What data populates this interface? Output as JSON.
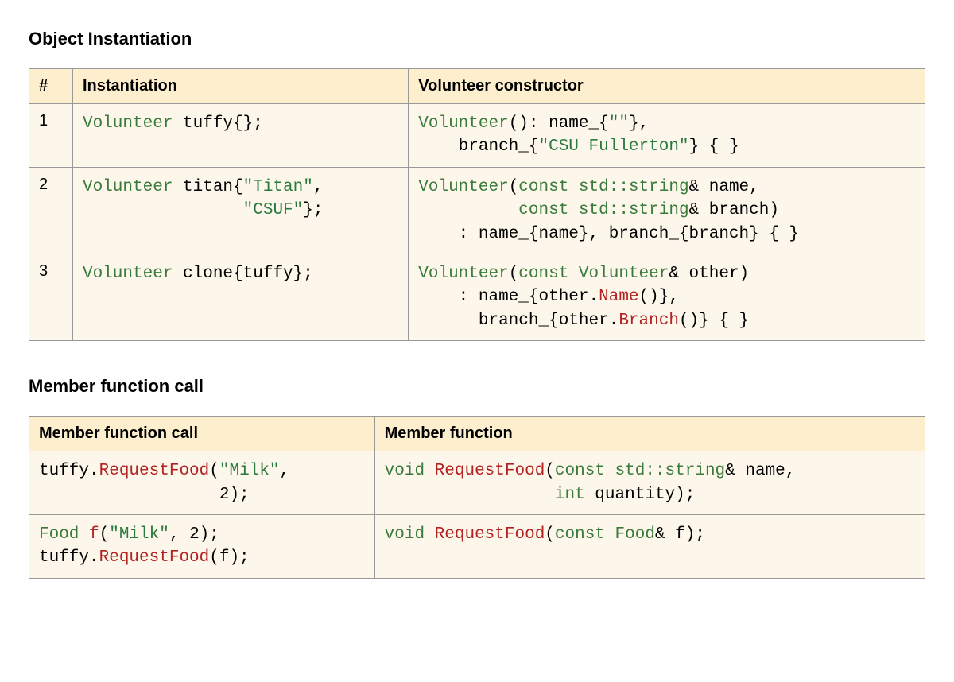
{
  "section1": {
    "title": "Object Instantiation",
    "headers": {
      "col1": "#",
      "col2": "Instantiation",
      "col3": "Volunteer constructor"
    },
    "rows": [
      {
        "num": "1",
        "instantiation": [
          {
            "cls": "k-type",
            "text": "Volunteer"
          },
          {
            "cls": "",
            "text": " tuffy{};"
          }
        ],
        "constructor": [
          {
            "cls": "k-type",
            "text": "Volunteer"
          },
          {
            "cls": "",
            "text": "(): name_{"
          },
          {
            "cls": "k-string",
            "text": "\"\""
          },
          {
            "cls": "",
            "text": "},\n    branch_{"
          },
          {
            "cls": "k-string",
            "text": "\"CSU Fullerton\""
          },
          {
            "cls": "",
            "text": "} { }"
          }
        ]
      },
      {
        "num": "2",
        "instantiation": [
          {
            "cls": "k-type",
            "text": "Volunteer"
          },
          {
            "cls": "",
            "text": " titan{"
          },
          {
            "cls": "k-string",
            "text": "\"Titan\""
          },
          {
            "cls": "",
            "text": ",\n                "
          },
          {
            "cls": "k-string",
            "text": "\"CSUF\""
          },
          {
            "cls": "",
            "text": "};"
          }
        ],
        "constructor": [
          {
            "cls": "k-type",
            "text": "Volunteer"
          },
          {
            "cls": "",
            "text": "("
          },
          {
            "cls": "k-keyword",
            "text": "const"
          },
          {
            "cls": "",
            "text": " "
          },
          {
            "cls": "k-type",
            "text": "std::string"
          },
          {
            "cls": "",
            "text": "& name,\n          "
          },
          {
            "cls": "k-keyword",
            "text": "const"
          },
          {
            "cls": "",
            "text": " "
          },
          {
            "cls": "k-type",
            "text": "std::string"
          },
          {
            "cls": "",
            "text": "& branch)\n    : name_{name}, branch_{branch} { }"
          }
        ]
      },
      {
        "num": "3",
        "instantiation": [
          {
            "cls": "k-type",
            "text": "Volunteer"
          },
          {
            "cls": "",
            "text": " clone{tuffy};"
          }
        ],
        "constructor": [
          {
            "cls": "k-type",
            "text": "Volunteer"
          },
          {
            "cls": "",
            "text": "("
          },
          {
            "cls": "k-keyword",
            "text": "const"
          },
          {
            "cls": "",
            "text": " "
          },
          {
            "cls": "k-type",
            "text": "Volunteer"
          },
          {
            "cls": "",
            "text": "& other)\n    : name_{other."
          },
          {
            "cls": "k-call",
            "text": "Name"
          },
          {
            "cls": "",
            "text": "()},\n      branch_{other."
          },
          {
            "cls": "k-call",
            "text": "Branch"
          },
          {
            "cls": "",
            "text": "()} { }"
          }
        ]
      }
    ]
  },
  "section2": {
    "title": "Member function call",
    "headers": {
      "col1": "Member function call",
      "col2": "Member function"
    },
    "rows": [
      {
        "call": [
          {
            "cls": "",
            "text": "tuffy."
          },
          {
            "cls": "k-call",
            "text": "RequestFood"
          },
          {
            "cls": "",
            "text": "("
          },
          {
            "cls": "k-string",
            "text": "\"Milk\""
          },
          {
            "cls": "",
            "text": ",\n                  2);"
          }
        ],
        "decl": [
          {
            "cls": "k-type",
            "text": "void"
          },
          {
            "cls": "",
            "text": " "
          },
          {
            "cls": "k-call",
            "text": "RequestFood"
          },
          {
            "cls": "",
            "text": "("
          },
          {
            "cls": "k-keyword",
            "text": "const"
          },
          {
            "cls": "",
            "text": " "
          },
          {
            "cls": "k-type",
            "text": "std::string"
          },
          {
            "cls": "",
            "text": "& name,\n                 "
          },
          {
            "cls": "k-type",
            "text": "int"
          },
          {
            "cls": "",
            "text": " quantity);"
          }
        ]
      },
      {
        "call": [
          {
            "cls": "k-type",
            "text": "Food"
          },
          {
            "cls": "",
            "text": " "
          },
          {
            "cls": "k-call",
            "text": "f"
          },
          {
            "cls": "",
            "text": "("
          },
          {
            "cls": "k-string",
            "text": "\"Milk\""
          },
          {
            "cls": "",
            "text": ", 2);\ntuffy."
          },
          {
            "cls": "k-call",
            "text": "RequestFood"
          },
          {
            "cls": "",
            "text": "(f);"
          }
        ],
        "decl": [
          {
            "cls": "k-type",
            "text": "void"
          },
          {
            "cls": "",
            "text": " "
          },
          {
            "cls": "k-call",
            "text": "RequestFood"
          },
          {
            "cls": "",
            "text": "("
          },
          {
            "cls": "k-keyword",
            "text": "const"
          },
          {
            "cls": "",
            "text": " "
          },
          {
            "cls": "k-type",
            "text": "Food"
          },
          {
            "cls": "",
            "text": "& f);"
          }
        ]
      }
    ]
  }
}
